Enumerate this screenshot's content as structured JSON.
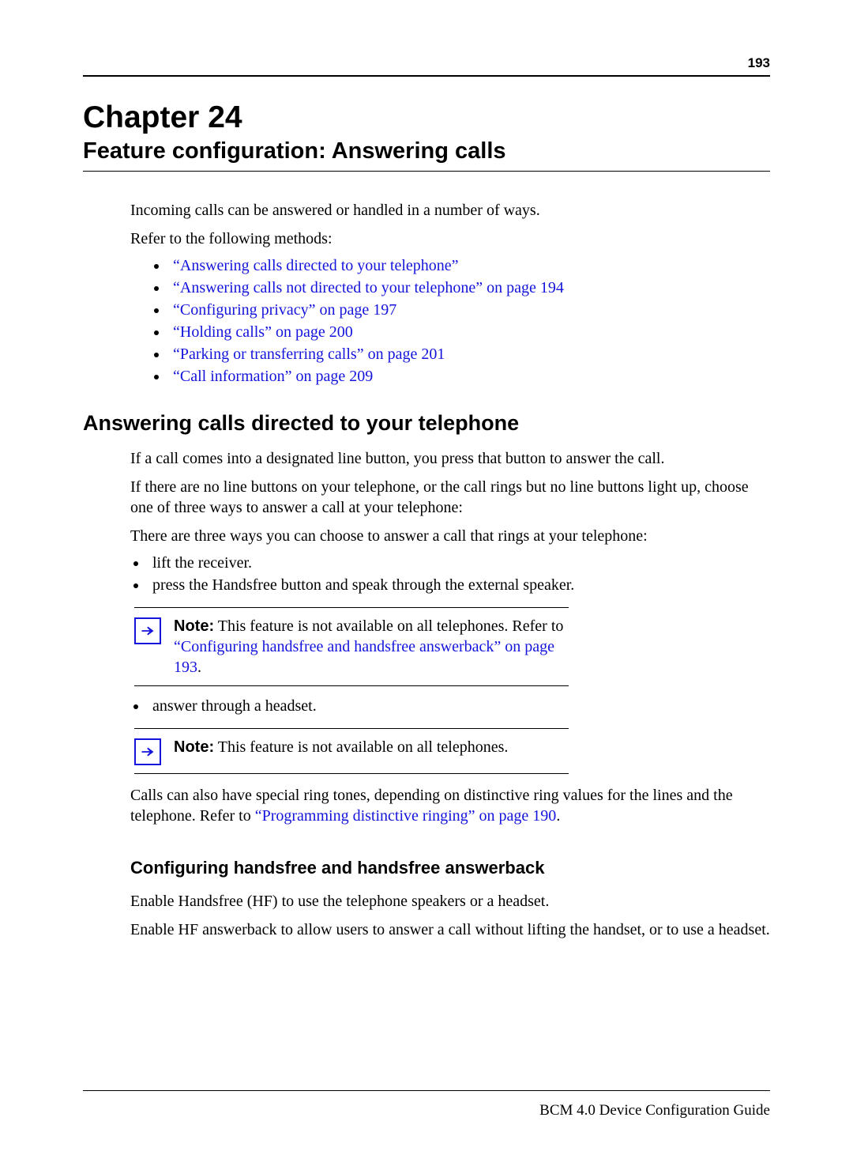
{
  "page_number": "193",
  "chapter_number": "Chapter 24",
  "chapter_title": "Feature configuration: Answering calls",
  "intro_p1": "Incoming calls can be answered or handled in a number of ways.",
  "intro_p2": "Refer to the following methods:",
  "links": {
    "l1": "“Answering calls directed to your telephone”",
    "l2": "“Answering calls not directed to your telephone” on page 194",
    "l3": "“Configuring privacy” on page 197",
    "l4": "“Holding calls” on page 200",
    "l5": "“Parking or transferring calls” on page 201",
    "l6": "“Call information” on page 209"
  },
  "section1_heading": "Answering calls directed to your telephone",
  "section1_p1": "If a call comes into a designated line button, you press that button to answer the call.",
  "section1_p2": "If there are no line buttons on your telephone, or the call rings but no line buttons light up, choose one of three ways to answer a call at your telephone:",
  "section1_p3": "There are three ways you can choose to answer a call that rings at your telephone:",
  "ways": {
    "w1": "lift the receiver.",
    "w2": "press the Handsfree button and speak through the external speaker.",
    "w3": "answer through a headset."
  },
  "note1_label": "Note:",
  "note1_text": " This feature is not available on all telephones. Refer to ",
  "note1_link": "“Configuring handsfree and handsfree answerback” on page 193",
  "note1_suffix": ".",
  "note2_label": "Note:",
  "note2_text": " This feature is not available on all telephones.",
  "closing_p_prefix": "Calls can also have special ring tones, depending on distinctive ring values for the lines and the telephone. Refer to ",
  "closing_link": "“Programming distinctive ringing” on page 190",
  "closing_suffix": ".",
  "subsection_heading": "Configuring handsfree and handsfree answerback",
  "sub_p1": "Enable Handsfree (HF) to use the telephone speakers or a headset.",
  "sub_p2": "Enable HF answerback to allow users to answer a call without lifting the handset, or to use a headset.",
  "footer_text": "BCM 4.0 Device Configuration Guide"
}
